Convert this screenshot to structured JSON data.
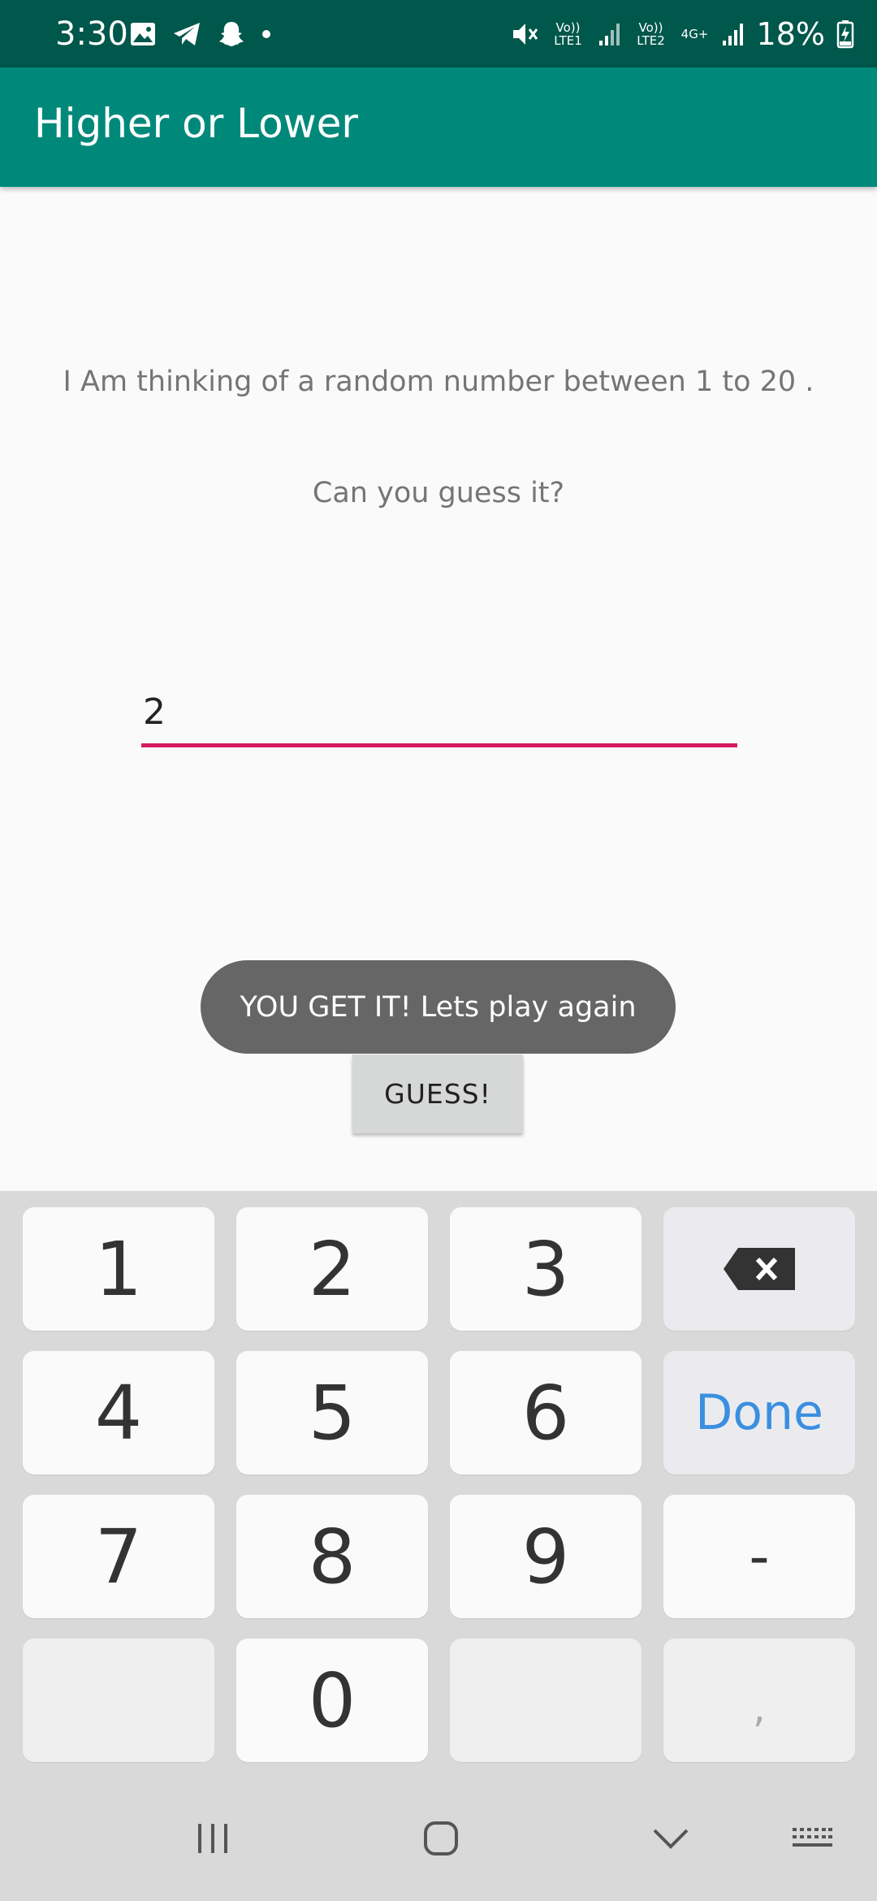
{
  "status_bar": {
    "time": "3:30",
    "sim1": "Vo)) LTE1",
    "sim2": "Vo)) LTE2",
    "network": "4G+",
    "battery_percent": "18%",
    "icons": [
      "gallery-icon",
      "telegram-icon",
      "snapchat-icon",
      "dot-icon",
      "mute-icon",
      "signal-icon",
      "battery-charging-icon"
    ]
  },
  "app_bar": {
    "title": "Higher or Lower",
    "color": "#00897b",
    "status_color": "#00574b"
  },
  "main": {
    "prompt_line1": "I Am thinking of a random number between 1 to 20 .",
    "prompt_line2": "Can you guess it?",
    "guess_value": "2",
    "accent_color": "#d81b60",
    "toast_text": "YOU GET IT!  Lets play again",
    "guess_button_label": "GUESS!"
  },
  "keyboard": {
    "keys": {
      "k1": "1",
      "k2": "2",
      "k3": "3",
      "k4": "4",
      "k5": "5",
      "k6": "6",
      "k7": "7",
      "k8": "8",
      "k9": "9",
      "k0": "0",
      "done": "Done",
      "minus": "-",
      "comma": ","
    },
    "backspace_icon": "backspace-icon"
  },
  "nav_bar": {
    "icons": [
      "recents-icon",
      "home-icon",
      "back-icon",
      "keyboard-icon"
    ]
  }
}
